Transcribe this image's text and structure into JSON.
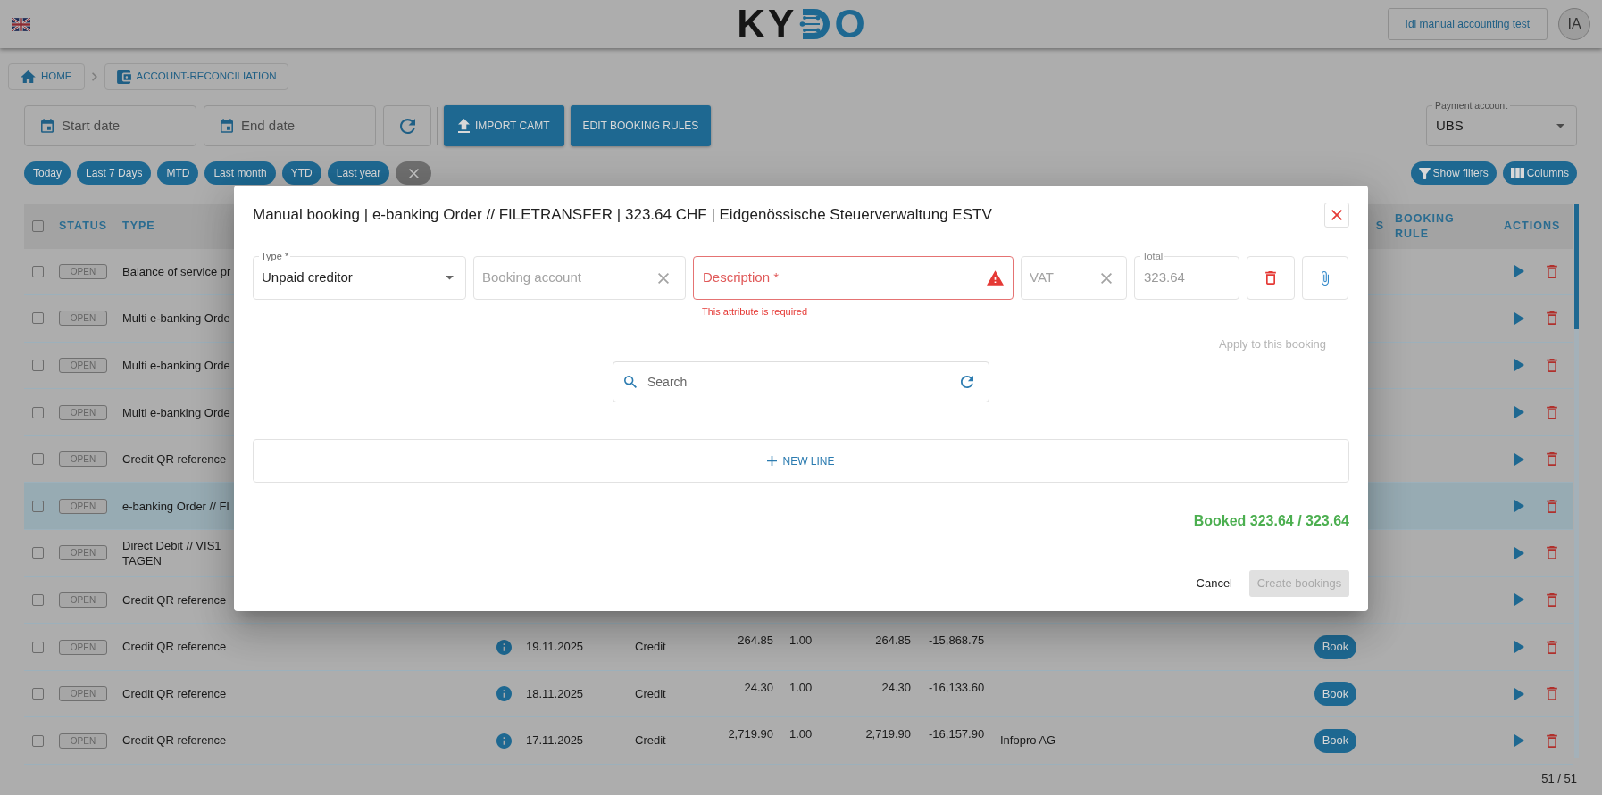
{
  "header": {
    "logo": {
      "lead": "KY",
      "tail": "O"
    },
    "org_button": "Idl manual accounting test",
    "avatar": "IA"
  },
  "breadcrumb": [
    "HOME",
    "ACCOUNT-RECONCILIATION"
  ],
  "toolbar": {
    "start_date": {
      "placeholder": "Start date"
    },
    "end_date": {
      "placeholder": "End date"
    },
    "import_button": "IMPORT CAMT",
    "rules_button": "EDIT BOOKING RULES",
    "payment_account": {
      "label": "Payment account",
      "value": "UBS"
    }
  },
  "quick_ranges": [
    "Today",
    "Last 7 Days",
    "MTD",
    "Last month",
    "YTD",
    "Last year"
  ],
  "table_buttons": [
    "Show filters",
    "Columns"
  ],
  "table": {
    "select_all": {
      "checked": false
    },
    "columns": [
      "STATUS",
      "TYPE",
      "S",
      "BOOKING RULE",
      "ACTIONS"
    ],
    "rows": [
      {
        "kind": "covered",
        "checked": false,
        "selected": false,
        "status": "OPEN",
        "type": "Balance of service pr"
      },
      {
        "kind": "covered",
        "checked": false,
        "selected": false,
        "status": "OPEN",
        "type": "Multi e-banking Orde"
      },
      {
        "kind": "covered",
        "checked": false,
        "selected": false,
        "status": "OPEN",
        "type": "Multi e-banking Orde"
      },
      {
        "kind": "covered",
        "checked": false,
        "selected": false,
        "status": "OPEN",
        "type": "Multi e-banking Orde"
      },
      {
        "kind": "covered",
        "checked": false,
        "selected": false,
        "status": "OPEN",
        "type": "Credit QR reference"
      },
      {
        "kind": "covered",
        "checked": false,
        "selected": true,
        "status": "OPEN",
        "type": "e-banking Order // FI"
      },
      {
        "kind": "covered",
        "checked": false,
        "selected": false,
        "status": "OPEN",
        "type": "Direct Debit // VIS1\nTAGEN"
      },
      {
        "kind": "covered",
        "checked": false,
        "selected": false,
        "status": "OPEN",
        "type": "Credit QR reference"
      },
      {
        "kind": "full",
        "checked": false,
        "selected": false,
        "status": "OPEN",
        "type": "Credit QR reference",
        "date": "19.11.2025",
        "column_6": "Credit",
        "column_7": "264.85",
        "column_8": "1.00",
        "column_9": "264.85",
        "column_10": "-15,868.75",
        "book": "Book"
      },
      {
        "kind": "full",
        "checked": false,
        "selected": false,
        "status": "OPEN",
        "type": "Credit QR reference",
        "date": "18.11.2025",
        "column_6": "Credit",
        "column_7": "24.30",
        "column_8": "1.00",
        "column_9": "24.30",
        "column_10": "-16,133.60",
        "book": "Book"
      },
      {
        "kind": "full",
        "checked": false,
        "selected": false,
        "status": "OPEN",
        "type": "Credit QR reference",
        "date": "17.11.2025",
        "column_6": "Credit",
        "column_7": "2,719.90",
        "column_8": "1.00",
        "column_9": "2,719.90",
        "column_10": "-16,157.90",
        "column_11": "Infopro AG",
        "book": "Book"
      }
    ]
  },
  "pagination": "51 / 51",
  "dialog": {
    "title": "Manual booking | e-banking Order // FILETRANSFER | 323.64 CHF | Eidgenössische Steuerverwaltung ESTV",
    "line": {
      "type": {
        "label": "Type *",
        "value": "Unpaid creditor"
      },
      "booking_account": {
        "placeholder": "Booking account"
      },
      "description": {
        "placeholder": "Description *",
        "error": "This attribute is required"
      },
      "vat": {
        "placeholder": "VAT"
      },
      "total": {
        "label": "Total",
        "value": "323.64",
        "disabled": true
      }
    },
    "apply_link": {
      "label": "Apply to this booking",
      "disabled": true
    },
    "search": {
      "placeholder": "Search"
    },
    "new_line_button": "NEW LINE",
    "booked": "Booked 323.64 / 323.64",
    "cancel_button": "Cancel",
    "create_button": {
      "label": "Create bookings",
      "disabled": true
    }
  }
}
